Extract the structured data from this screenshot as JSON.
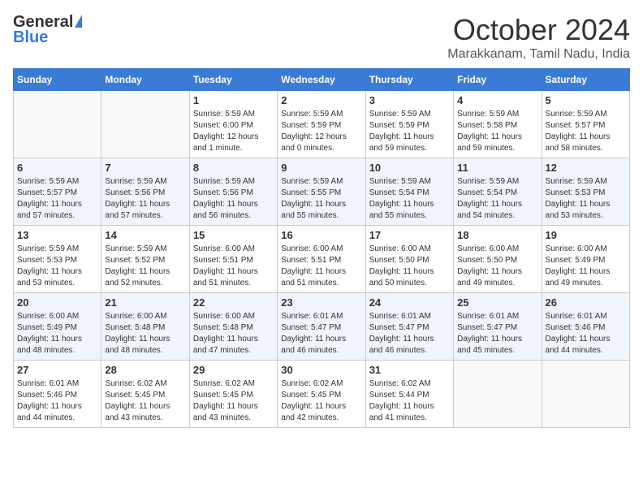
{
  "header": {
    "logo_general": "General",
    "logo_blue": "Blue",
    "month_title": "October 2024",
    "location": "Marakkanam, Tamil Nadu, India"
  },
  "weekdays": [
    "Sunday",
    "Monday",
    "Tuesday",
    "Wednesday",
    "Thursday",
    "Friday",
    "Saturday"
  ],
  "weeks": [
    [
      {
        "day": "",
        "info": ""
      },
      {
        "day": "",
        "info": ""
      },
      {
        "day": "1",
        "info": "Sunrise: 5:59 AM\nSunset: 6:00 PM\nDaylight: 12 hours\nand 1 minute."
      },
      {
        "day": "2",
        "info": "Sunrise: 5:59 AM\nSunset: 5:59 PM\nDaylight: 12 hours\nand 0 minutes."
      },
      {
        "day": "3",
        "info": "Sunrise: 5:59 AM\nSunset: 5:59 PM\nDaylight: 11 hours\nand 59 minutes."
      },
      {
        "day": "4",
        "info": "Sunrise: 5:59 AM\nSunset: 5:58 PM\nDaylight: 11 hours\nand 59 minutes."
      },
      {
        "day": "5",
        "info": "Sunrise: 5:59 AM\nSunset: 5:57 PM\nDaylight: 11 hours\nand 58 minutes."
      }
    ],
    [
      {
        "day": "6",
        "info": "Sunrise: 5:59 AM\nSunset: 5:57 PM\nDaylight: 11 hours\nand 57 minutes."
      },
      {
        "day": "7",
        "info": "Sunrise: 5:59 AM\nSunset: 5:56 PM\nDaylight: 11 hours\nand 57 minutes."
      },
      {
        "day": "8",
        "info": "Sunrise: 5:59 AM\nSunset: 5:56 PM\nDaylight: 11 hours\nand 56 minutes."
      },
      {
        "day": "9",
        "info": "Sunrise: 5:59 AM\nSunset: 5:55 PM\nDaylight: 11 hours\nand 55 minutes."
      },
      {
        "day": "10",
        "info": "Sunrise: 5:59 AM\nSunset: 5:54 PM\nDaylight: 11 hours\nand 55 minutes."
      },
      {
        "day": "11",
        "info": "Sunrise: 5:59 AM\nSunset: 5:54 PM\nDaylight: 11 hours\nand 54 minutes."
      },
      {
        "day": "12",
        "info": "Sunrise: 5:59 AM\nSunset: 5:53 PM\nDaylight: 11 hours\nand 53 minutes."
      }
    ],
    [
      {
        "day": "13",
        "info": "Sunrise: 5:59 AM\nSunset: 5:53 PM\nDaylight: 11 hours\nand 53 minutes."
      },
      {
        "day": "14",
        "info": "Sunrise: 5:59 AM\nSunset: 5:52 PM\nDaylight: 11 hours\nand 52 minutes."
      },
      {
        "day": "15",
        "info": "Sunrise: 6:00 AM\nSunset: 5:51 PM\nDaylight: 11 hours\nand 51 minutes."
      },
      {
        "day": "16",
        "info": "Sunrise: 6:00 AM\nSunset: 5:51 PM\nDaylight: 11 hours\nand 51 minutes."
      },
      {
        "day": "17",
        "info": "Sunrise: 6:00 AM\nSunset: 5:50 PM\nDaylight: 11 hours\nand 50 minutes."
      },
      {
        "day": "18",
        "info": "Sunrise: 6:00 AM\nSunset: 5:50 PM\nDaylight: 11 hours\nand 49 minutes."
      },
      {
        "day": "19",
        "info": "Sunrise: 6:00 AM\nSunset: 5:49 PM\nDaylight: 11 hours\nand 49 minutes."
      }
    ],
    [
      {
        "day": "20",
        "info": "Sunrise: 6:00 AM\nSunset: 5:49 PM\nDaylight: 11 hours\nand 48 minutes."
      },
      {
        "day": "21",
        "info": "Sunrise: 6:00 AM\nSunset: 5:48 PM\nDaylight: 11 hours\nand 48 minutes."
      },
      {
        "day": "22",
        "info": "Sunrise: 6:00 AM\nSunset: 5:48 PM\nDaylight: 11 hours\nand 47 minutes."
      },
      {
        "day": "23",
        "info": "Sunrise: 6:01 AM\nSunset: 5:47 PM\nDaylight: 11 hours\nand 46 minutes."
      },
      {
        "day": "24",
        "info": "Sunrise: 6:01 AM\nSunset: 5:47 PM\nDaylight: 11 hours\nand 46 minutes."
      },
      {
        "day": "25",
        "info": "Sunrise: 6:01 AM\nSunset: 5:47 PM\nDaylight: 11 hours\nand 45 minutes."
      },
      {
        "day": "26",
        "info": "Sunrise: 6:01 AM\nSunset: 5:46 PM\nDaylight: 11 hours\nand 44 minutes."
      }
    ],
    [
      {
        "day": "27",
        "info": "Sunrise: 6:01 AM\nSunset: 5:46 PM\nDaylight: 11 hours\nand 44 minutes."
      },
      {
        "day": "28",
        "info": "Sunrise: 6:02 AM\nSunset: 5:45 PM\nDaylight: 11 hours\nand 43 minutes."
      },
      {
        "day": "29",
        "info": "Sunrise: 6:02 AM\nSunset: 5:45 PM\nDaylight: 11 hours\nand 43 minutes."
      },
      {
        "day": "30",
        "info": "Sunrise: 6:02 AM\nSunset: 5:45 PM\nDaylight: 11 hours\nand 42 minutes."
      },
      {
        "day": "31",
        "info": "Sunrise: 6:02 AM\nSunset: 5:44 PM\nDaylight: 11 hours\nand 41 minutes."
      },
      {
        "day": "",
        "info": ""
      },
      {
        "day": "",
        "info": ""
      }
    ]
  ]
}
